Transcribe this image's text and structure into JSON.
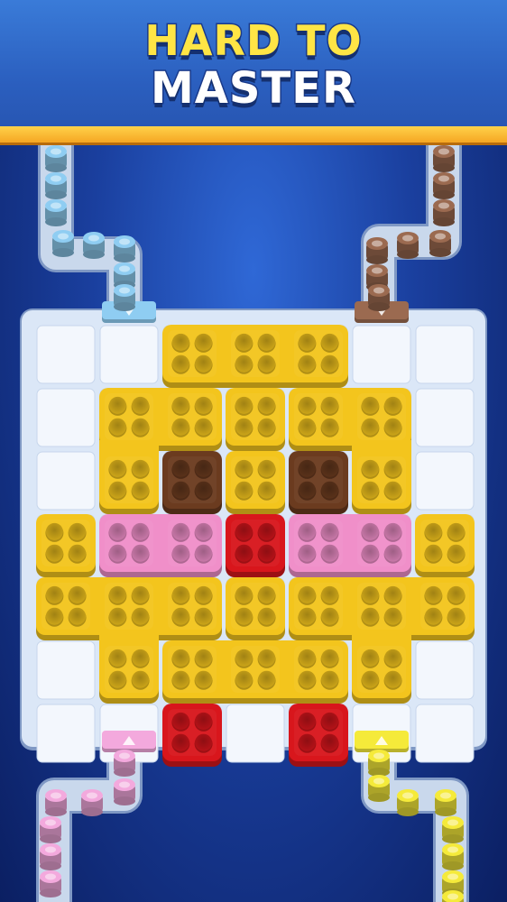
{
  "header": {
    "title_line1": "HARD TO",
    "title_line2": "MASTER"
  },
  "colors": {
    "yellow": "#f3c51d",
    "pink": "#f08fc9",
    "brown": "#6b3b1f",
    "red": "#d8161c",
    "blue_peg": "#8fcdf2",
    "brown_peg": "#9b6a50",
    "pink_peg": "#f3a9dd",
    "yellow_peg": "#f5ea3a"
  },
  "board": {
    "columns": 7,
    "rows": 7,
    "pieces": [
      {
        "color": "yellow",
        "cells": [
          [
            2,
            0
          ],
          [
            3,
            0
          ],
          [
            4,
            0
          ]
        ]
      },
      {
        "color": "yellow",
        "cells": [
          [
            1,
            1
          ],
          [
            2,
            1
          ],
          [
            1,
            2
          ]
        ]
      },
      {
        "color": "yellow",
        "cells": [
          [
            3,
            1
          ]
        ]
      },
      {
        "color": "yellow",
        "cells": [
          [
            4,
            1
          ],
          [
            5,
            1
          ],
          [
            5,
            2
          ]
        ]
      },
      {
        "color": "brown",
        "cells": [
          [
            2,
            2
          ]
        ]
      },
      {
        "color": "yellow",
        "cells": [
          [
            3,
            2
          ]
        ]
      },
      {
        "color": "brown",
        "cells": [
          [
            4,
            2
          ]
        ]
      },
      {
        "color": "yellow",
        "cells": [
          [
            0,
            3
          ]
        ]
      },
      {
        "color": "pink",
        "cells": [
          [
            1,
            3
          ],
          [
            2,
            3
          ]
        ]
      },
      {
        "color": "red",
        "cells": [
          [
            3,
            3
          ]
        ]
      },
      {
        "color": "pink",
        "cells": [
          [
            4,
            3
          ],
          [
            5,
            3
          ]
        ]
      },
      {
        "color": "yellow",
        "cells": [
          [
            6,
            3
          ]
        ]
      },
      {
        "color": "yellow",
        "cells": [
          [
            0,
            4
          ],
          [
            1,
            4
          ],
          [
            2,
            4
          ],
          [
            1,
            5
          ]
        ]
      },
      {
        "color": "yellow",
        "cells": [
          [
            3,
            4
          ]
        ]
      },
      {
        "color": "yellow",
        "cells": [
          [
            4,
            4
          ],
          [
            5,
            4
          ],
          [
            6,
            4
          ],
          [
            5,
            5
          ]
        ]
      },
      {
        "color": "yellow",
        "cells": [
          [
            2,
            5
          ],
          [
            3,
            5
          ],
          [
            4,
            5
          ]
        ]
      },
      {
        "color": "red",
        "cells": [
          [
            2,
            6
          ]
        ]
      },
      {
        "color": "red",
        "cells": [
          [
            4,
            6
          ]
        ]
      }
    ]
  },
  "exits": [
    {
      "color": "blue_peg",
      "side": "top",
      "column": 1
    },
    {
      "color": "brown_peg",
      "side": "top",
      "column": 5
    },
    {
      "color": "pink_peg",
      "side": "bottom",
      "column": 1
    },
    {
      "color": "yellow_peg",
      "side": "bottom",
      "column": 5
    }
  ],
  "peg_queues": [
    {
      "color": "blue_peg",
      "corner": "top-left",
      "count": 8
    },
    {
      "color": "brown_peg",
      "corner": "top-right",
      "count": 8
    },
    {
      "color": "pink_peg",
      "corner": "bottom-left",
      "count": 7
    },
    {
      "color": "yellow_peg",
      "corner": "bottom-right",
      "count": 8
    }
  ]
}
